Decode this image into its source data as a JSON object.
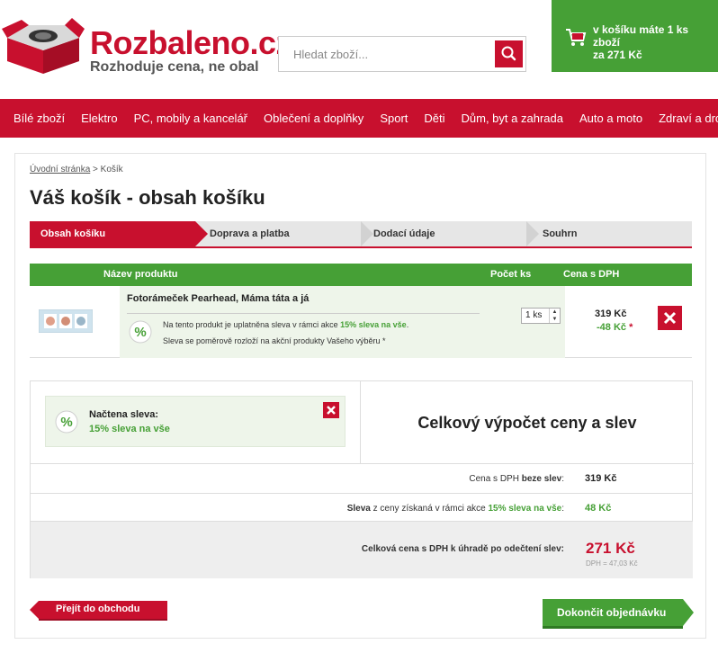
{
  "brand": {
    "name": "Rozbaleno.cz",
    "tagline": "Rozhoduje cena, ne obal",
    "red": "#c8102e",
    "green": "#46a036"
  },
  "search": {
    "placeholder": "Hledat zboží...",
    "icon": "search-icon"
  },
  "cart_widget": {
    "line1": "v košíku máte 1 ks zboží",
    "line2": "za 271 Kč",
    "icon": "shopping-cart-icon"
  },
  "nav": {
    "items": [
      "Bílé zboží",
      "Elektro",
      "PC, mobily a kancelář",
      "Oblečení a doplňky",
      "Sport",
      "Děti",
      "Dům, byt a zahrada",
      "Auto a moto",
      "Zdraví a drogerie"
    ]
  },
  "breadcrumb": {
    "home": "Úvodní stránka",
    "separator": ">",
    "current": "Košík"
  },
  "page": {
    "title": "Váš košík - obsah košíku"
  },
  "steps": [
    {
      "label": "Obsah košíku",
      "active": true
    },
    {
      "label": "Doprava a platba",
      "active": false
    },
    {
      "label": "Dodací údaje",
      "active": false
    },
    {
      "label": "Souhrn",
      "active": false
    }
  ],
  "cart_table": {
    "headers": {
      "product": "Název produktu",
      "quantity": "Počet ks",
      "price": "Cena s DPH"
    },
    "items": [
      {
        "name": "Fotorámeček Pearhead, Máma táta a já",
        "promo_text_prefix": "Na tento produkt je uplatněna sleva v rámci akce",
        "promo_name": "15% sleva na vše",
        "promo_note": "Sleva se poměrově rozloží na akční produkty Vašeho výběru *",
        "quantity": "1 ks",
        "price": "319 Kč",
        "discount": "-48 Kč",
        "discount_mark": "*"
      }
    ]
  },
  "coupon": {
    "title": "Načtena sleva:",
    "value": "15% sleva na vše"
  },
  "summary": {
    "title": "Celkový výpočet ceny a slev",
    "rows": {
      "base": {
        "label_prefix": "Cena s DPH",
        "label_bold": "beze slev",
        "label_suffix": ":",
        "value": "319 Kč"
      },
      "discount": {
        "label_bold1": "Sleva",
        "label_mid": "z ceny získaná v rámci akce",
        "label_green": "15% sleva na vše",
        "label_suffix": ":",
        "value": "48 Kč"
      },
      "total": {
        "label": "Celková cena s DPH k úhradě po odečtení slev:",
        "value": "271 Kč",
        "vat_note": "DPH = 47,03 Kč"
      }
    }
  },
  "buttons": {
    "back": "Přejít do obchodu",
    "finish": "Dokončit objednávku"
  }
}
